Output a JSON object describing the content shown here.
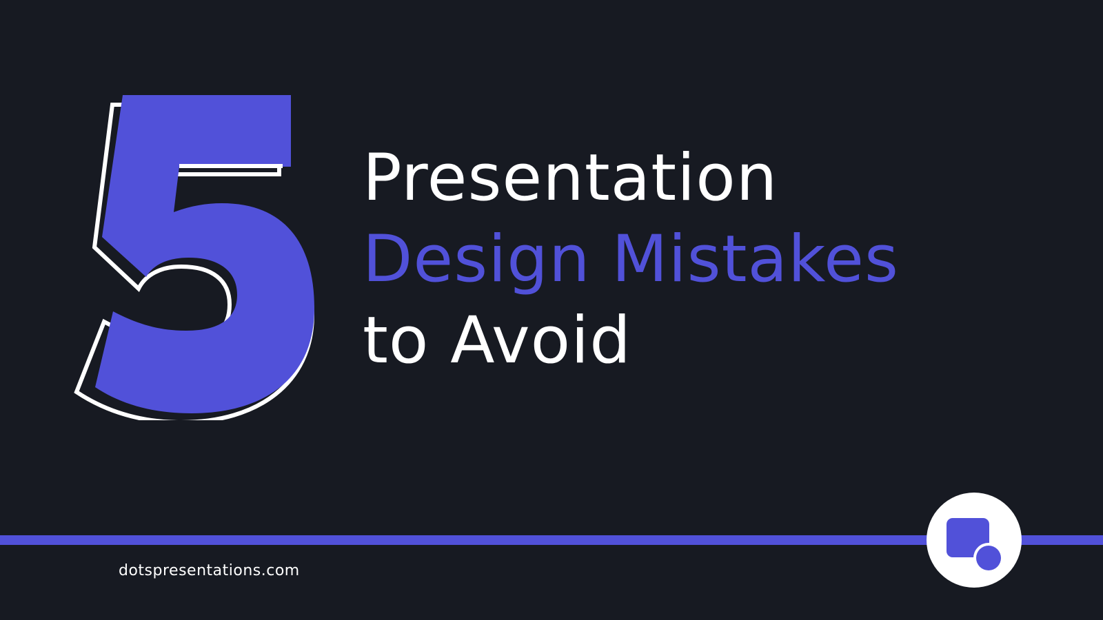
{
  "slide": {
    "number": "5",
    "title_lines": {
      "line1": "Presentation",
      "line2": "Design Mistakes",
      "line3": "to Avoid"
    },
    "footer_url": "dotspresentations.com",
    "logo": "dots-presentations-logo-icon"
  },
  "colors": {
    "background": "#171a22",
    "accent": "#5151d9",
    "text": "#ffffff"
  }
}
